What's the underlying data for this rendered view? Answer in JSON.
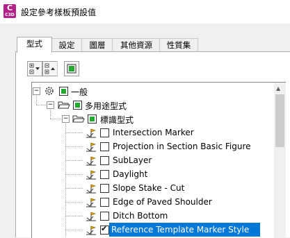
{
  "window": {
    "title": "設定參考樣板預設值",
    "app_icon_text": "C",
    "app_icon_sub": "C3D"
  },
  "tabs": [
    {
      "label": "型式",
      "active": true
    },
    {
      "label": "設定",
      "active": false
    },
    {
      "label": "圖層",
      "active": false
    },
    {
      "label": "其他資源",
      "active": false
    },
    {
      "label": "性質集",
      "active": false
    }
  ],
  "toolbar": {
    "expand_icon": "expand-tree-icon",
    "collapse_icon": "collapse-tree-icon",
    "toggle_icon": "toggle-style-icon"
  },
  "tree": {
    "root": {
      "label": "一般",
      "state": "filled"
    },
    "level1": {
      "label": "多用途型式",
      "state": "filled"
    },
    "level2": {
      "label": "標識型式",
      "state": "filled"
    },
    "items": [
      {
        "label": "Intersection Marker",
        "state": "unchecked"
      },
      {
        "label": "Projection in Section Basic Figure",
        "state": "unchecked"
      },
      {
        "label": "SubLayer",
        "state": "unchecked"
      },
      {
        "label": "Daylight",
        "state": "unchecked"
      },
      {
        "label": "Slope Stake - Cut",
        "state": "unchecked"
      },
      {
        "label": "Edge of Paved Shoulder",
        "state": "unchecked"
      },
      {
        "label": "Ditch Bottom",
        "state": "unchecked"
      },
      {
        "label": "Reference Template Marker Style",
        "state": "checked",
        "selected": true
      }
    ]
  },
  "colors": {
    "accent": "#0078d7",
    "check_fill": "#22aa2e",
    "brand": "#b0228a"
  }
}
